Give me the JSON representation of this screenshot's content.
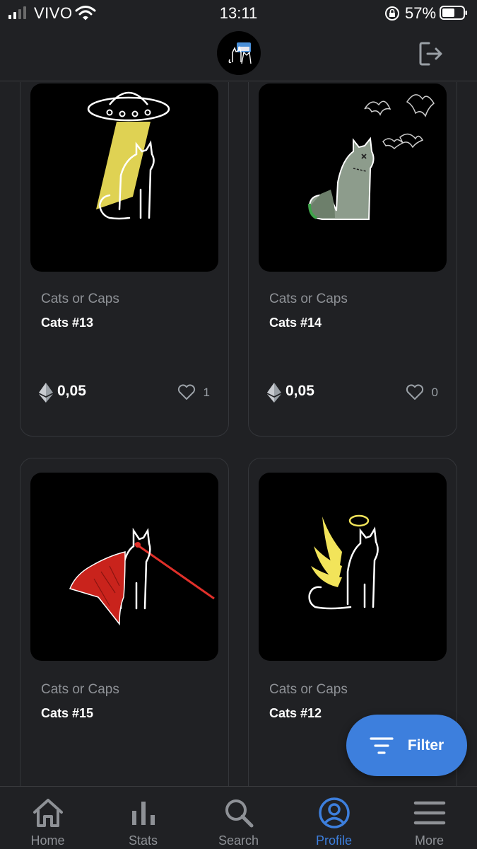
{
  "status_bar": {
    "carrier": "VIVO",
    "time": "13:11",
    "battery_percent": "57%"
  },
  "header": {
    "avatar_icon": "cat-avatar-icon",
    "logout_icon": "logout-icon"
  },
  "cards": [
    {
      "collection": "Cats or Caps",
      "name": "Cats #13",
      "price": "0,05",
      "likes": "1",
      "art": "ufo-cat"
    },
    {
      "collection": "Cats or Caps",
      "name": "Cats #14",
      "price": "0,05",
      "likes": "0",
      "art": "zombie-cat"
    },
    {
      "collection": "Cats or Caps",
      "name": "Cats #15",
      "art": "caped-laser-cat"
    },
    {
      "collection": "Cats or Caps",
      "name": "Cats #12",
      "art": "angel-cat"
    }
  ],
  "filter_button": {
    "label": "Filter",
    "icon": "filter-icon"
  },
  "tabs": [
    {
      "label": "Home",
      "icon": "home-icon",
      "active": false
    },
    {
      "label": "Stats",
      "icon": "stats-icon",
      "active": false
    },
    {
      "label": "Search",
      "icon": "search-icon",
      "active": false
    },
    {
      "label": "Profile",
      "icon": "profile-icon",
      "active": true
    },
    {
      "label": "More",
      "icon": "menu-icon",
      "active": false
    }
  ],
  "colors": {
    "background": "#202124",
    "accent": "#3d7fdd",
    "muted_text": "#8e9196"
  }
}
